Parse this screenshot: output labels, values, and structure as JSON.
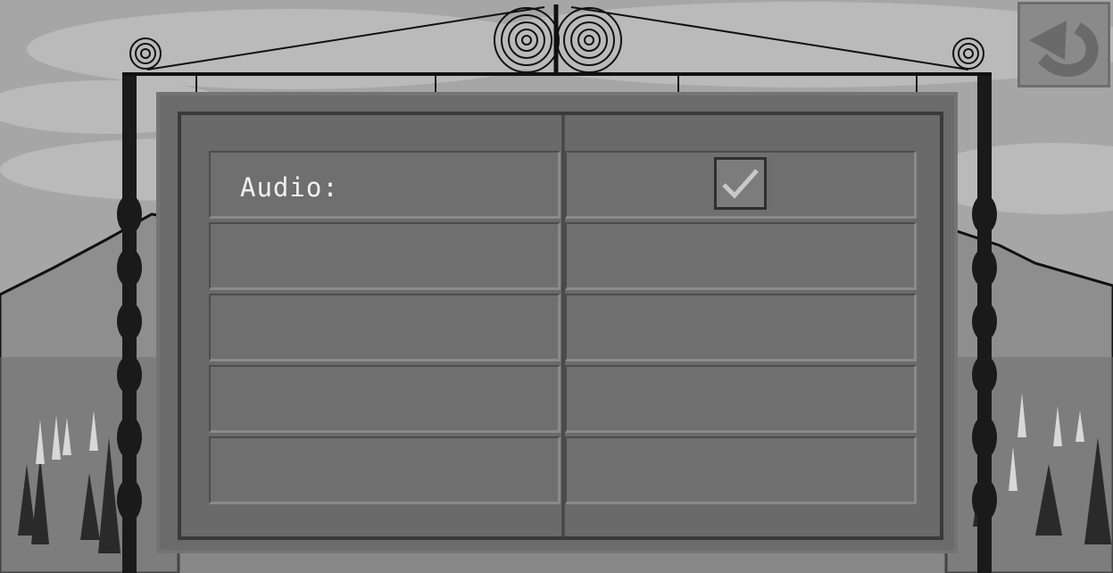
{
  "settings": {
    "rows": [
      {
        "label": "Audio:",
        "control": "checkbox",
        "checked": true
      },
      {
        "label": "",
        "control": "none"
      },
      {
        "label": "",
        "control": "none"
      },
      {
        "label": "",
        "control": "none"
      },
      {
        "label": "",
        "control": "none"
      }
    ]
  },
  "icons": {
    "back": "undo-arrow-icon",
    "checkmark": "checkmark-icon"
  },
  "colors": {
    "board": "#6b6b6b",
    "cell": "#6f6f6f",
    "text": "#f0f0f0",
    "sky": "#a9a9a9"
  }
}
